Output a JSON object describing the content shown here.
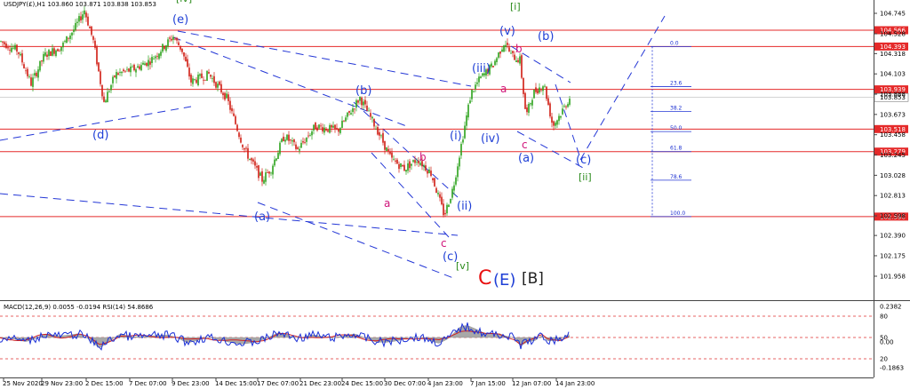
{
  "chart_data": {
    "type": "candlestick",
    "title": "USDJPY(£),H1  103.860 103.871 103.838 103.853",
    "y_ticks": [
      "104.745",
      "104.528",
      "104.318",
      "104.103",
      "103.888",
      "103.673",
      "103.458",
      "103.245",
      "103.028",
      "102.813",
      "102.598",
      "102.390",
      "102.175",
      "101.958"
    ],
    "x_ticks": [
      "25 Nov 2020",
      "29 Nov 23:00",
      "2 Dec 15:00",
      "7 Dec 07:00",
      "9 Dec 23:00",
      "14 Dec 15:00",
      "17 Dec 07:00",
      "21 Dec 23:00",
      "24 Dec 15:00",
      "30 Dec 07:00",
      "4 Jan 23:00",
      "7 Jan 15:00",
      "12 Jan 07:00",
      "14 Jan 23:00"
    ],
    "current_price": "103.853",
    "price_levels": [
      {
        "value": 104.566,
        "label": "104.566"
      },
      {
        "value": 104.393,
        "label": "104.393"
      },
      {
        "value": 103.939,
        "label": "103.939"
      },
      {
        "value": 103.518,
        "label": "103.518"
      },
      {
        "value": 103.279,
        "label": "103.279"
      },
      {
        "value": 102.59,
        "label": "102.590"
      }
    ],
    "fibonacci_levels": [
      "0.0",
      "23.6",
      "38.2",
      "50.0",
      "61.8",
      "78.6",
      "100.0"
    ],
    "wave_labels": [
      "[iv]",
      "(e)",
      "(d)",
      "(b)",
      "(a)",
      "a",
      "b",
      "(c)",
      "c",
      "[v]",
      "(i)",
      "(ii)",
      "(iii)",
      "(iv)",
      "(v)",
      "b",
      "a",
      "c",
      "(a)",
      "(b)",
      "(c)",
      "[i]",
      "[ii]"
    ],
    "big_label": {
      "c": "C",
      "e": "(E)",
      "b": "[B]"
    },
    "macd_label": "MACD(12,26,9) 0.0055 -0.0194 RSI(14) 54.8686",
    "macd_ticks": [
      "0.2382",
      "80",
      "50",
      "0.00",
      "20",
      "-0.1863"
    ],
    "colors": {
      "bull": "#2aa11a",
      "bear": "#d01c12",
      "level": "#e52a2a",
      "trend": "#2437d6",
      "wave_blue": "#1f3fd6",
      "wave_pink": "#d0147a",
      "wave_green": "#2a8a1a"
    }
  }
}
